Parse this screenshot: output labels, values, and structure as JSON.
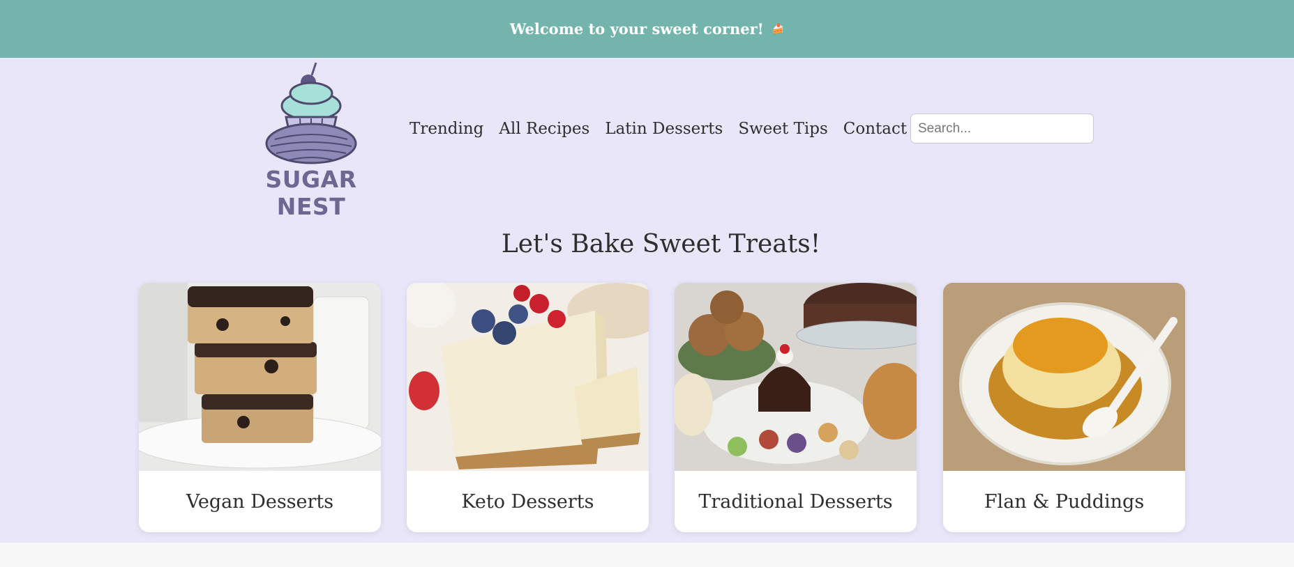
{
  "banner": {
    "text": "Welcome to your sweet corner!",
    "icon": "cake-icon"
  },
  "logo": {
    "brand": "SUGAR NEST"
  },
  "nav": {
    "items": [
      {
        "label": "Trending"
      },
      {
        "label": "All Recipes"
      },
      {
        "label": "Latin Desserts"
      },
      {
        "label": "Sweet Tips"
      },
      {
        "label": "Contact"
      }
    ]
  },
  "search": {
    "placeholder": "Search..."
  },
  "hero": {
    "title": "Let's Bake Sweet Treats!"
  },
  "categories": [
    {
      "label": "Vegan Desserts"
    },
    {
      "label": "Keto Desserts"
    },
    {
      "label": "Traditional Desserts"
    },
    {
      "label": "Flan & Puddings"
    }
  ],
  "colors": {
    "banner": "#73b4ac",
    "page": "#e8e6f8",
    "brand": "#6d6791",
    "cupcake_frosting": "#a6e0d8"
  }
}
